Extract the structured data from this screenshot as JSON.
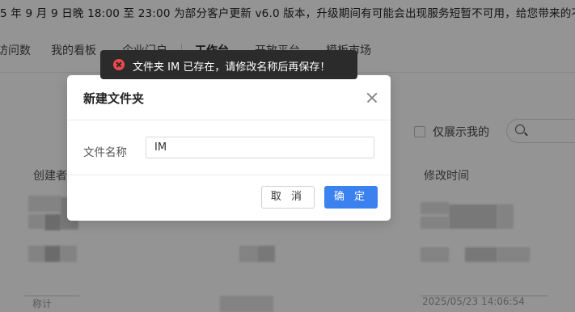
{
  "banner": {
    "text": "5 年 9 月 9 日晚 18:00 至 23:00 为部分客户更新 v6.0 版本，升级期间有可能会出现服务短暂不可用，给您带来的不"
  },
  "nav": {
    "items": [
      "访问数",
      "我的看板",
      "企业门户",
      "工作台",
      "开放平台",
      "模板市场"
    ]
  },
  "filters": {
    "only_mine_label": "仅展示我的"
  },
  "table": {
    "columns": [
      "创建者",
      "修改时间"
    ],
    "faint_values": [
      "称计",
      "2025/05/23 14:06:54"
    ]
  },
  "toast": {
    "message": "文件夹 IM 已存在，请修改名称后再保存！",
    "icon": "error-circle-icon",
    "color": "#f0484f"
  },
  "dialog": {
    "title": "新建文件夹",
    "field_label": "文件名称",
    "field_value": "IM",
    "cancel_label": "取 消",
    "ok_label": "确 定",
    "accent": "#3b82f0"
  }
}
